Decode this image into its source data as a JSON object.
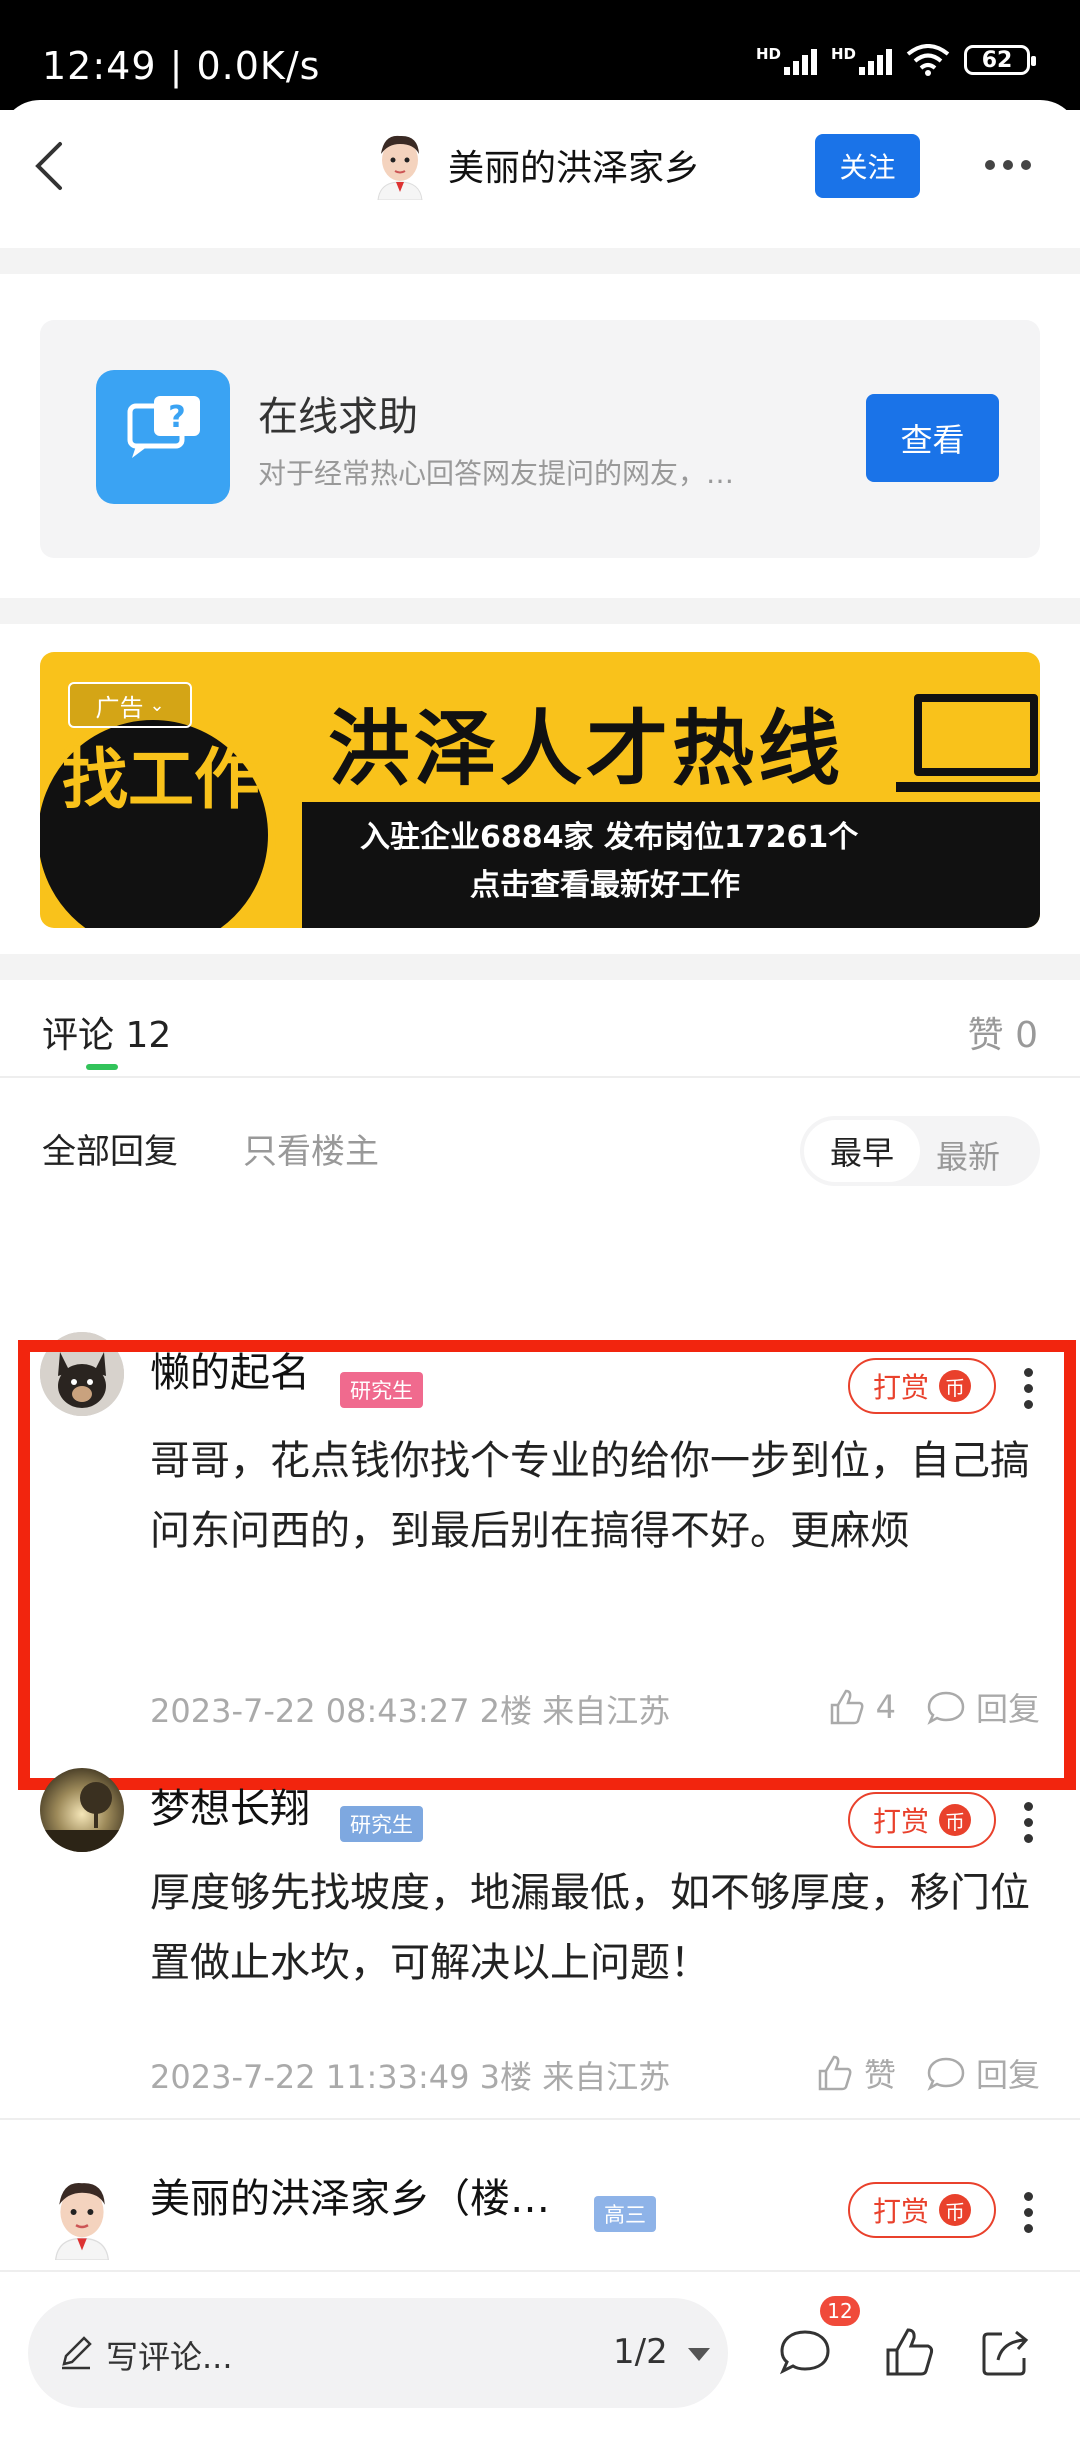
{
  "status_bar": {
    "time": "12:49 | 0.0K/s",
    "signal1_label": "HD",
    "signal2_label": "HD",
    "battery": "62"
  },
  "header": {
    "title": "美丽的洪泽家乡",
    "follow_label": "关注"
  },
  "help_card": {
    "title": "在线求助",
    "description": "对于经常热心回答网友提问的网友，…",
    "button_label": "查看"
  },
  "ad_banner": {
    "tag": "广告",
    "circle_text": "找工作",
    "headline": "洪泽人才热线",
    "line1": "入驻企业6884家  发布岗位17261个",
    "line2": "点击查看最新好工作"
  },
  "comment_tabs": {
    "comments_label": "评论 12",
    "likes_label": "赞 0"
  },
  "filters": {
    "all_label": "全部回复",
    "host_only_label": "只看楼主",
    "sort_early": "最早",
    "sort_latest": "最新"
  },
  "comments": [
    {
      "username": "懒的起名",
      "badge": "研究生",
      "badge_color": "#f06a8e",
      "tip_label": "打赏",
      "body": "哥哥，花点钱你找个专业的给你一步到位，自己搞问东问西的，到最后别在搞得不好。更麻烦",
      "meta": "2023-7-22 08:43:27  2楼  来自江苏",
      "likes": "4",
      "reply_label": "回复"
    },
    {
      "username": "梦想长翔",
      "badge": "研究生",
      "badge_color": "#7ea8e0",
      "tip_label": "打赏",
      "body": "厚度够先找坡度，地漏最低，如不够厚度，移门位置做止水坎，可解决以上问题！",
      "meta": "2023-7-22 11:33:49  3楼  来自江苏",
      "likes": "赞",
      "reply_label": "回复"
    },
    {
      "username": "美丽的洪泽家乡（楼…",
      "badge": "高三",
      "badge_color": "#8eb3e8",
      "tip_label": "打赏"
    }
  ],
  "bottom_bar": {
    "placeholder": "写评论...",
    "pager": "1/2",
    "comment_count": "12"
  },
  "colors": {
    "accent": "#1a73e8",
    "tip_red": "#e9412c",
    "highlight": "#f2250e",
    "ad_yellow": "#f9c21b"
  }
}
